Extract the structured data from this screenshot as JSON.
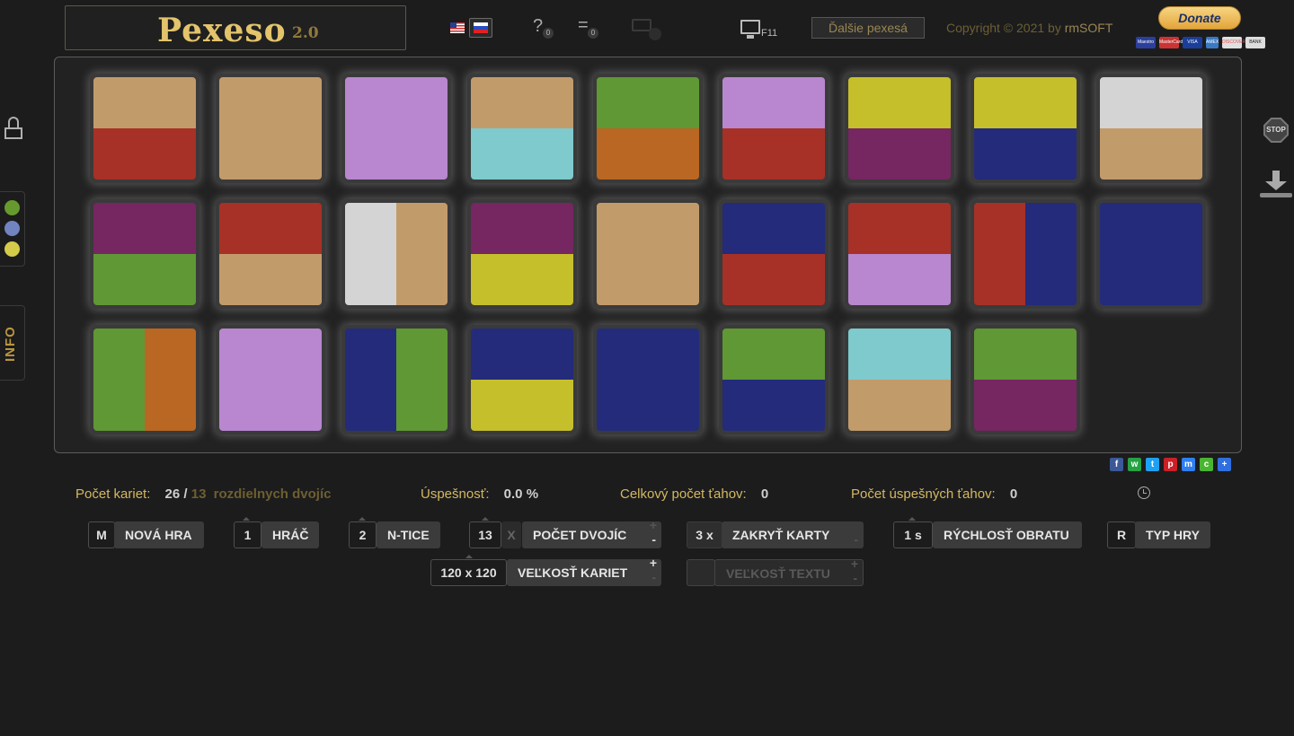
{
  "header": {
    "app_name": "Pexeso",
    "version": "2.0",
    "help_icon": "?",
    "help_count": "0",
    "list_icon": "=",
    "list_count": "0",
    "fullscreen_key": "F11",
    "more_games": "Ďalšie pexesá",
    "copyright_prefix": "Copyright © 2021 by ",
    "copyright_brand": "rmSOFT",
    "donate": "Donate",
    "payments": [
      "Maestro",
      "MasterCard",
      "VISA",
      "AMEX",
      "DISCOVER",
      "BANK"
    ]
  },
  "side": {
    "info_label": "INFO",
    "stop_label": "STOP",
    "color_dots": [
      "#679a2e",
      "#7184c0",
      "#d4cb4b"
    ]
  },
  "palette": {
    "tan": "#c29b6b",
    "red": "#a73127",
    "lilac": "#b887cf",
    "cyan": "#7ecacd",
    "green": "#5f9834",
    "orange": "#b96722",
    "yellow": "#c5bf2b",
    "purple": "#762661",
    "navy": "#232b7a",
    "gray": "#d4d4d4"
  },
  "cards": [
    {
      "split": "h",
      "colors": [
        "tan",
        "red"
      ]
    },
    {
      "split": "h",
      "colors": [
        "tan",
        "tan"
      ]
    },
    {
      "split": "h",
      "colors": [
        "lilac",
        "lilac"
      ]
    },
    {
      "split": "h",
      "colors": [
        "tan",
        "cyan"
      ]
    },
    {
      "split": "h",
      "colors": [
        "green",
        "orange"
      ]
    },
    {
      "split": "h",
      "colors": [
        "lilac",
        "red"
      ]
    },
    {
      "split": "h",
      "colors": [
        "yellow",
        "purple"
      ]
    },
    {
      "split": "h",
      "colors": [
        "yellow",
        "navy"
      ]
    },
    {
      "split": "h",
      "colors": [
        "gray",
        "tan"
      ]
    },
    {
      "split": "h",
      "colors": [
        "purple",
        "green"
      ]
    },
    {
      "split": "h",
      "colors": [
        "red",
        "tan"
      ]
    },
    {
      "split": "v",
      "colors": [
        "gray",
        "tan"
      ]
    },
    {
      "split": "h",
      "colors": [
        "purple",
        "yellow"
      ]
    },
    {
      "split": "h",
      "colors": [
        "tan",
        "tan"
      ]
    },
    {
      "split": "h",
      "colors": [
        "navy",
        "red"
      ]
    },
    {
      "split": "h",
      "colors": [
        "red",
        "lilac"
      ]
    },
    {
      "split": "v",
      "colors": [
        "red",
        "navy"
      ]
    },
    {
      "split": "h",
      "colors": [
        "navy",
        "navy"
      ]
    },
    {
      "split": "v",
      "colors": [
        "green",
        "orange"
      ]
    },
    {
      "split": "h",
      "colors": [
        "lilac",
        "lilac"
      ]
    },
    {
      "split": "v",
      "colors": [
        "navy",
        "green"
      ]
    },
    {
      "split": "h",
      "colors": [
        "navy",
        "yellow"
      ]
    },
    {
      "split": "h",
      "colors": [
        "navy",
        "navy"
      ]
    },
    {
      "split": "h",
      "colors": [
        "green",
        "navy"
      ]
    },
    {
      "split": "h",
      "colors": [
        "cyan",
        "tan"
      ]
    },
    {
      "split": "h",
      "colors": [
        "green",
        "purple"
      ]
    }
  ],
  "share_icons": [
    "f",
    "w",
    "t",
    "p",
    "m",
    "c",
    "+"
  ],
  "stats": {
    "cards_label": "Počet kariet:",
    "cards_value": "26 /",
    "pairs_value": "13",
    "pairs_label": "rozdielnych dvojíc",
    "success_label": "Úspešnosť:",
    "success_value": "0.0 %",
    "moves_label": "Celkový počet ťahov:",
    "moves_value": "0",
    "good_moves_label": "Počet úspešných ťahov:",
    "good_moves_value": "0"
  },
  "controls": {
    "new_game_key": "M",
    "new_game": "NOVÁ HRA",
    "player_val": "1",
    "player": "HRÁČ",
    "ntice_val": "2",
    "ntice": "N-TICE",
    "pairs_val": "13",
    "pairs_x": "X",
    "pairs": "POČET DVOJÍC",
    "cover_val": "3 x",
    "cover": "ZAKRYŤ KARTY",
    "speed_val": "1 s",
    "speed": "RÝCHLOSŤ OBRATU",
    "type_key": "R",
    "type": "TYP HRY",
    "size_val": "120 x 120",
    "size": "VEĽKOSŤ KARIET",
    "text_size": "VEĽKOSŤ TEXTU",
    "plus": "+",
    "minus": "-"
  }
}
